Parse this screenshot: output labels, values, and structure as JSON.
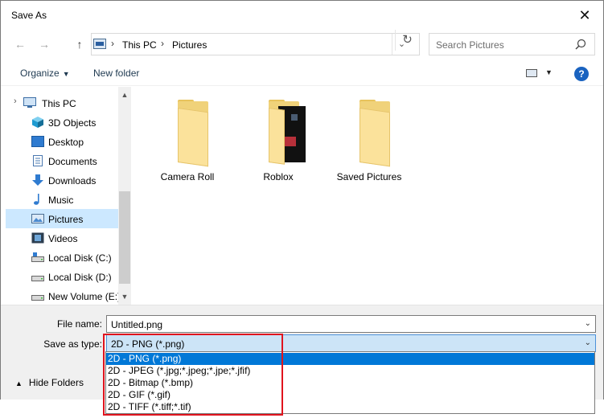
{
  "window": {
    "title": "Save As"
  },
  "nav": {
    "back": "←",
    "forward": "→",
    "up": "↑",
    "breadcrumb": [
      "This PC",
      "Pictures"
    ],
    "search_placeholder": "Search Pictures"
  },
  "toolbar": {
    "organize": "Organize",
    "new_folder": "New folder",
    "help": "?"
  },
  "sidebar": {
    "items": [
      {
        "label": "This PC",
        "icon": "computer-icon"
      },
      {
        "label": "3D Objects",
        "icon": "cube-icon"
      },
      {
        "label": "Desktop",
        "icon": "desktop-icon"
      },
      {
        "label": "Documents",
        "icon": "document-icon"
      },
      {
        "label": "Downloads",
        "icon": "download-icon"
      },
      {
        "label": "Music",
        "icon": "music-note-icon"
      },
      {
        "label": "Pictures",
        "icon": "pictures-icon",
        "selected": true
      },
      {
        "label": "Videos",
        "icon": "film-icon"
      },
      {
        "label": "Local Disk (C:)",
        "icon": "drive-icon"
      },
      {
        "label": "Local Disk (D:)",
        "icon": "drive-icon"
      },
      {
        "label": "New Volume (E:)",
        "icon": "drive-icon"
      }
    ]
  },
  "folders": [
    {
      "name": "Camera Roll"
    },
    {
      "name": "Roblox"
    },
    {
      "name": "Saved Pictures"
    }
  ],
  "form": {
    "file_name_label": "File name:",
    "file_name_value": "Untitled.png",
    "save_type_label": "Save as type:",
    "save_type_value": "2D - PNG (*.png)",
    "hide_folders": "Hide Folders"
  },
  "type_options": [
    "2D - PNG (*.png)",
    "2D - JPEG (*.jpg;*.jpeg;*.jpe;*.jfif)",
    "2D - Bitmap (*.bmp)",
    "2D - GIF (*.gif)",
    "2D - TIFF (*.tiff;*.tif)"
  ],
  "colors": {
    "accent": "#0078d7",
    "highlight_box": "#e0141e",
    "folder": "#fbe29b"
  }
}
